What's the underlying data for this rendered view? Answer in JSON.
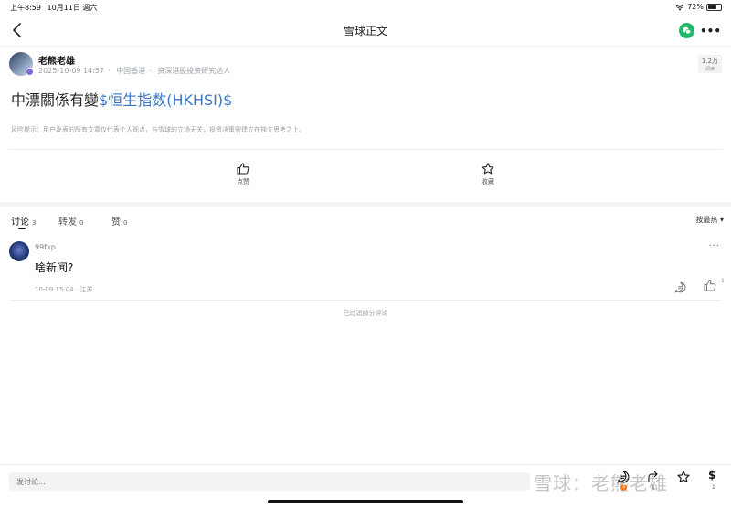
{
  "status_bar": {
    "time": "上午8:59",
    "date": "10月11日 週六",
    "battery": "72%",
    "battery_level": 0.72
  },
  "nav": {
    "title": "雪球正文"
  },
  "author": {
    "name": "老熊老雄",
    "time": "2025-10-09 14:57",
    "location": "中国香港",
    "title": "资深港股投资研究达人",
    "reads_count": "1.2万",
    "reads_label": "阅读"
  },
  "post": {
    "title_text": "中漂關係有變",
    "title_link": "$恒生指数(HKHSI)$"
  },
  "risk_notice": "风险提示：用户发表的所有文章仅代表个人观点，与雪球的立场无关，投资决策需建立在独立思考之上。",
  "actions": {
    "like_label": "点赞",
    "favorite_label": "收藏"
  },
  "tabs": [
    {
      "label": "讨论",
      "count": "3"
    },
    {
      "label": "转发",
      "count": "0"
    },
    {
      "label": "赞",
      "count": "0"
    }
  ],
  "sort_label": "按最热 ▾",
  "comment": {
    "user": "99fxp",
    "text": "啥新闻?",
    "meta": "10-09 15:04 · 江苏",
    "like_count": "1"
  },
  "filtered_note": "已过滤部分评论",
  "bottom": {
    "input_placeholder": "发讨论...",
    "watermark": "雪球：老熊老雄",
    "comment_badge": "3",
    "forward_count": "1",
    "reward_symbol": "$",
    "reward_count": "1"
  },
  "colors": {
    "link": "#3b75c4",
    "wechat": "#21b86b",
    "badge": "#f07b22"
  },
  "icons": [
    "back-icon",
    "wechat-icon",
    "more-icon",
    "thumbs-up-icon",
    "star-icon",
    "reply-icon",
    "comment-icon",
    "forward-icon"
  ]
}
